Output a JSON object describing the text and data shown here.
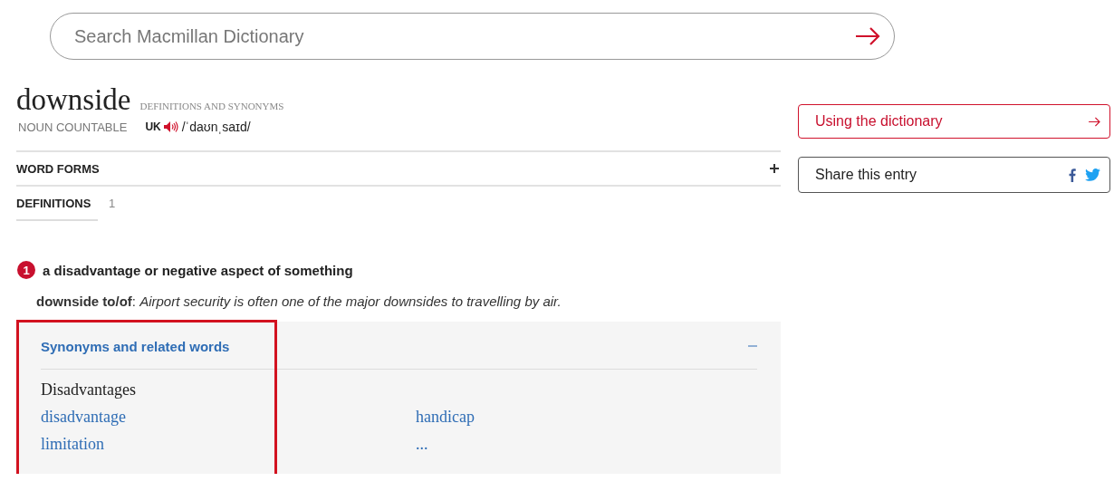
{
  "search": {
    "placeholder": "Search Macmillan Dictionary"
  },
  "entry": {
    "headword": "downside",
    "subtitle": "DEFINITIONS AND SYNONYMS",
    "part_of_speech": "NOUN COUNTABLE",
    "region": "UK",
    "pronunciation": "/ˈdaʊnˌsaɪd/"
  },
  "sections": [
    {
      "label": "WORD FORMS",
      "expanded": false
    },
    {
      "label": "DEFINITIONS",
      "count": "1",
      "selected": true
    }
  ],
  "definitions": [
    {
      "number": "1",
      "text": "a disadvantage or negative aspect of something",
      "example": "**downside to/of**: *Airport security is often one of the major downsides to travelling by air.*"
    }
  ],
  "synonyms": {
    "title": "Synonyms and related words",
    "expanded": true,
    "highlighted": true,
    "group": "Disadvantages",
    "words": [
      "disadvantage",
      "handicap",
      "limitation",
      "..."
    ]
  },
  "sidebar": {
    "guide_link": "Using the dictionary",
    "share_label": "Share this entry"
  }
}
